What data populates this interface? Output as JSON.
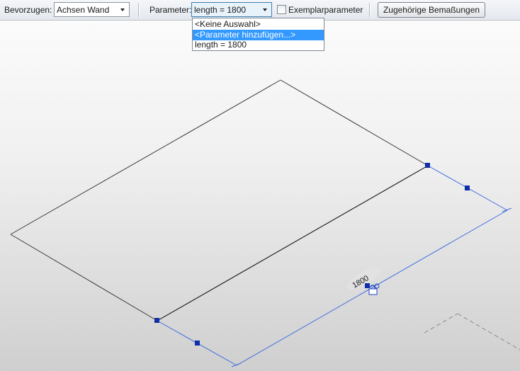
{
  "toolbar": {
    "prefer_label": "Bevorzugen:",
    "prefer_value": "Achsen Wand",
    "parameter_label": "Parameter:",
    "parameter_value": "length = 1800",
    "instance_parameter_label": "Exemplarparameter",
    "instance_parameter_checked": false,
    "related_dimensions_button": "Zugehörige Bemaßungen"
  },
  "parameter_dropdown": {
    "open": true,
    "items": [
      {
        "label": "<Keine Auswahl>",
        "selected": false
      },
      {
        "label": "<Parameter hinzufügen...>",
        "selected": true
      },
      {
        "label": "length = 1800",
        "selected": false
      }
    ]
  },
  "canvas": {
    "dimension_value": "1800",
    "model_line_color": "#3a3a3a",
    "dimension_line_color": "#3f6fe0",
    "grip_color": "#0f2fa8"
  }
}
